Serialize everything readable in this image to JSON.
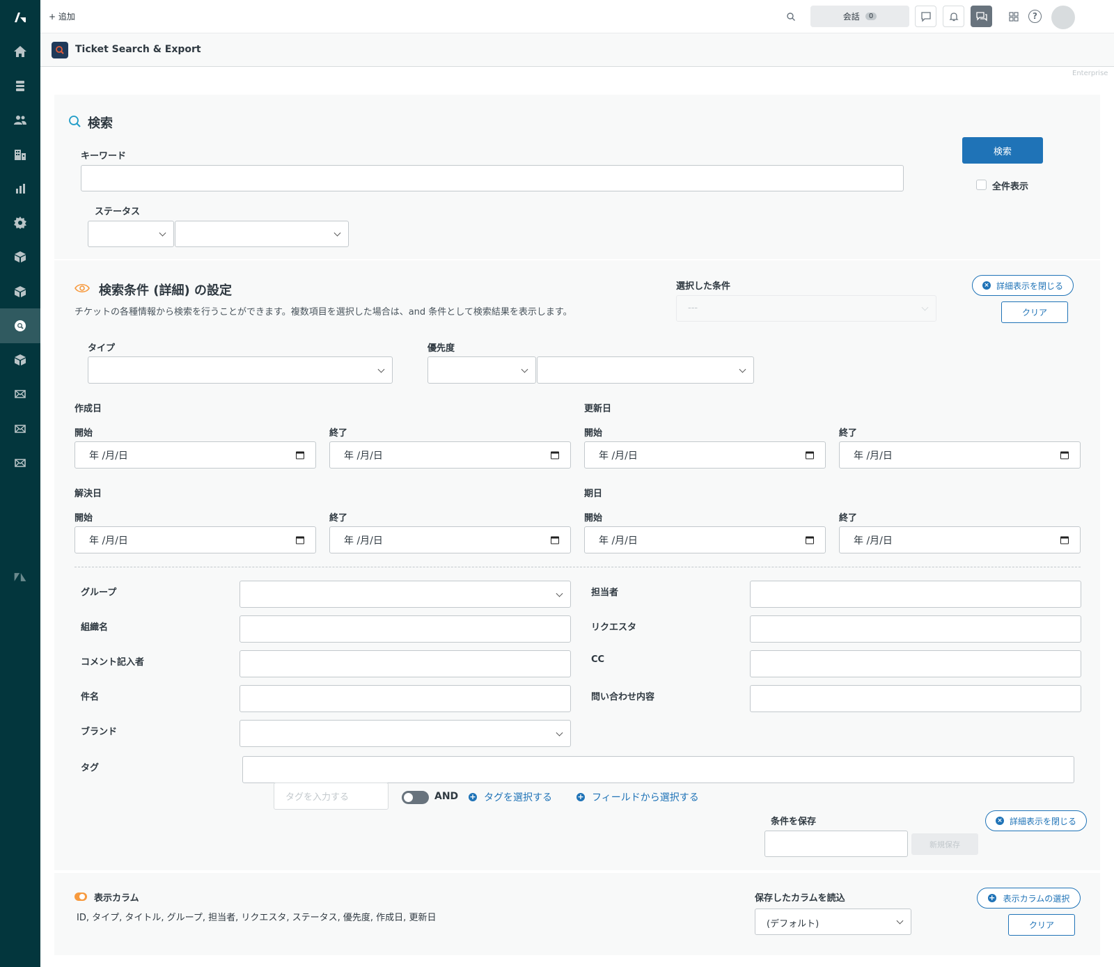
{
  "topbar": {
    "add_label": "+ 追加",
    "conversations_label": "会話",
    "conversations_count": "0"
  },
  "app": {
    "title": "Ticket Search & Export",
    "plan": "Enterprise"
  },
  "search": {
    "heading": "検索",
    "keyword_label": "キーワード",
    "status_label": "ステータス",
    "search_button": "検索",
    "show_all_label": "全件表示"
  },
  "advanced": {
    "heading": "検索条件 (詳細) の設定",
    "description": "チケットの各種情報から検索を行うことができます。複数項目を選択した場合は、and 条件として検索結果を表示します。",
    "selected_conditions_label": "選択した条件",
    "selected_conditions_value": "---",
    "close_detail_button": "詳細表示を閉じる",
    "clear_button": "クリア",
    "type_label": "タイプ",
    "priority_label": "優先度",
    "date_placeholder": "年 /月/日",
    "start_label": "開始",
    "end_label": "終了",
    "created_label": "作成日",
    "updated_label": "更新日",
    "solved_label": "解決日",
    "due_label": "期日",
    "group_label": "グループ",
    "assignee_label": "担当者",
    "org_label": "組織名",
    "requester_label": "リクエスタ",
    "commenter_label": "コメント記入者",
    "cc_label": "CC",
    "subject_label": "件名",
    "inquiry_label": "問い合わせ内容",
    "brand_label": "ブランド",
    "tag_label": "タグ",
    "tag_input_placeholder": "タグを入力する",
    "and_label": "AND",
    "select_tag_link": "タグを選択する",
    "select_from_field_link": "フィールドから選択する",
    "save_condition_label": "条件を保存",
    "new_save_button": "新規保存"
  },
  "columns": {
    "heading": "表示カラム",
    "list": "ID, タイプ, タイトル, グループ, 担当者, リクエスタ, ステータス, 優先度, 作成日, 更新日",
    "load_saved_label": "保存したカラムを読込",
    "load_saved_value": "(デフォルト)",
    "select_columns_button": "表示カラムの選択",
    "clear_button": "クリア"
  },
  "colors": {
    "sidebar": "#03363d",
    "primary": "#1f73b7",
    "accent_orange": "#f79a3e"
  }
}
